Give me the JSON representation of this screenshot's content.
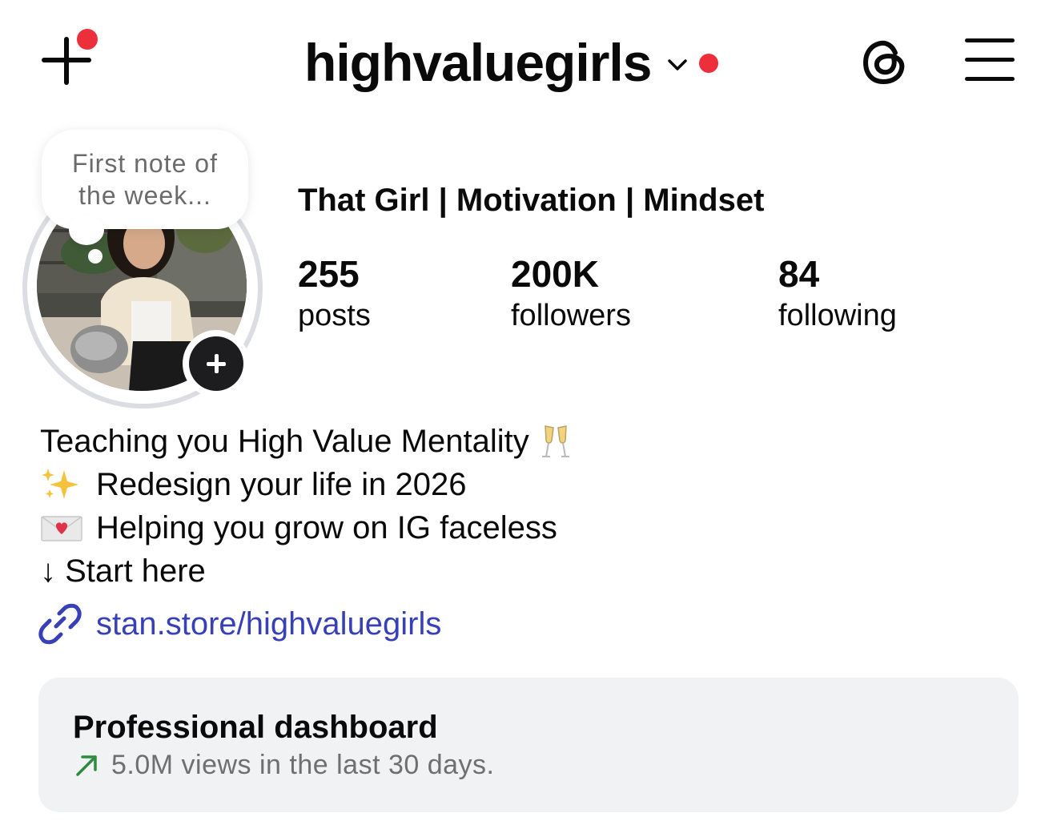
{
  "header": {
    "username": "highvaluegirls",
    "new_post_icon": "plus-icon",
    "threads_icon": "threads-icon",
    "menu_icon": "hamburger-menu-icon",
    "notification_color": "#ec2f3b"
  },
  "note": {
    "text": "First note of the week..."
  },
  "profile": {
    "display_name": "That Girl | Motivation | Mindset",
    "stats": [
      {
        "value": "255",
        "label": "posts"
      },
      {
        "value": "200K",
        "label": "followers"
      },
      {
        "value": "84",
        "label": "following"
      }
    ]
  },
  "bio": {
    "lines": [
      "Teaching you High Value Mentality",
      "Redesign your life in 2026",
      "Helping you grow on IG faceless",
      "↓ Start here"
    ]
  },
  "link": {
    "text": "stan.store/highvaluegirls",
    "color": "#3740b7"
  },
  "dashboard": {
    "title": "Professional dashboard",
    "subtitle": "5.0M views in the last 30 days.",
    "trend_color": "#2e8b3d"
  }
}
